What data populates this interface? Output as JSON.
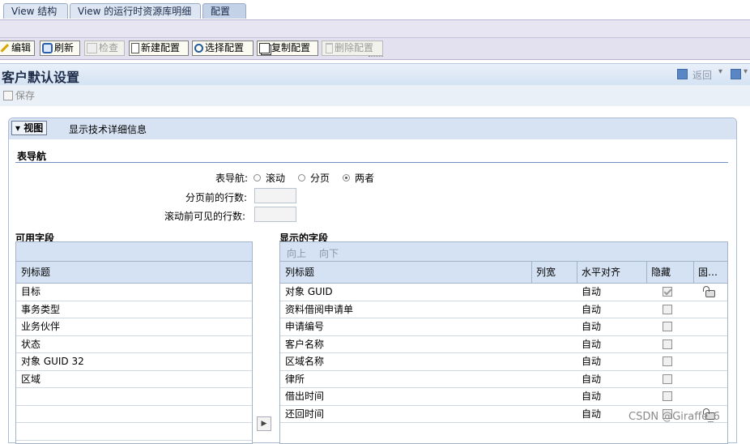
{
  "tabs": [
    {
      "label": "View 结构"
    },
    {
      "label": "View 的运行时资源库明细"
    },
    {
      "label": "配置"
    }
  ],
  "toolbar": {
    "edit": "编辑",
    "refresh": "刷新",
    "check": "检查",
    "new_config": "新建配置",
    "select_config": "选择配置",
    "copy_config": "复制配置",
    "delete_config": "删除配置"
  },
  "page": {
    "title": "客户默认设置",
    "back": "返回",
    "save": "保存"
  },
  "panel": {
    "view_button": "视图",
    "tech_details": "显示技术详细信息"
  },
  "table_nav": {
    "section": "表导航",
    "label": "表导航:",
    "options": [
      "滚动",
      "分页",
      "两者"
    ],
    "selected": "两者",
    "rows_before_paging_label": "分页前的行数:",
    "rows_before_paging_value": "",
    "visible_rows_before_scroll_label": "滚动前可见的行数:",
    "visible_rows_before_scroll_value": ""
  },
  "available": {
    "title": "可用字段",
    "col_header": "列标题",
    "rows": [
      "目标",
      "事务类型",
      "业务伙伴",
      "状态",
      "对象 GUID 32",
      "区域"
    ]
  },
  "displayed": {
    "title": "显示的字段",
    "up": "向上",
    "down": "向下",
    "headers": {
      "col": "列标题",
      "width": "列宽",
      "align": "水平对齐",
      "hidden": "隐藏",
      "fixed": "固…"
    },
    "rows": [
      {
        "label": "对象 GUID",
        "align": "自动",
        "hidden": true,
        "fixed": true
      },
      {
        "label": "资料借阅申请单",
        "align": "自动",
        "hidden": false,
        "fixed": false
      },
      {
        "label": "申请编号",
        "align": "自动",
        "hidden": false,
        "fixed": false
      },
      {
        "label": "客户名称",
        "align": "自动",
        "hidden": false,
        "fixed": false
      },
      {
        "label": "区域名称",
        "align": "自动",
        "hidden": false,
        "fixed": false
      },
      {
        "label": "律所",
        "align": "自动",
        "hidden": false,
        "fixed": false
      },
      {
        "label": "借出时间",
        "align": "自动",
        "hidden": false,
        "fixed": false
      },
      {
        "label": "还回时间",
        "align": "自动",
        "hidden": false,
        "fixed": true
      }
    ]
  },
  "watermark": "CSDN @Giraffe_6"
}
